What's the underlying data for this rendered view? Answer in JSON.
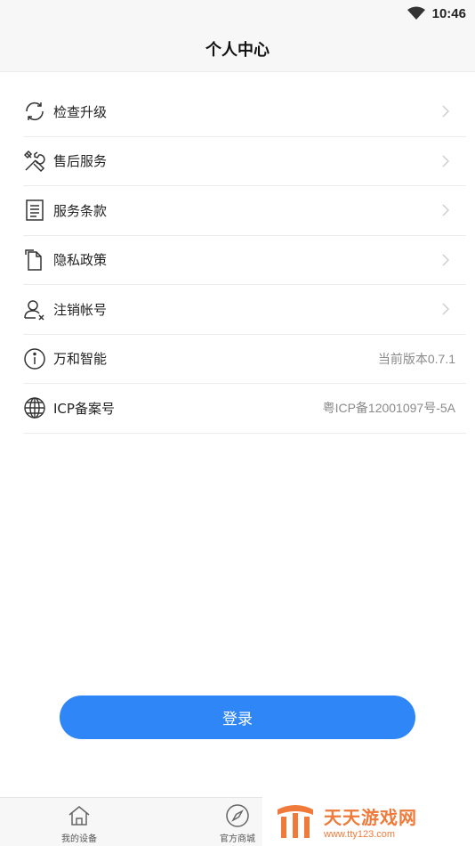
{
  "status": {
    "time": "10:46"
  },
  "header": {
    "title": "个人中心"
  },
  "menu": {
    "items": [
      {
        "label": "检查升级",
        "icon": "refresh-icon"
      },
      {
        "label": "售后服务",
        "icon": "tools-icon"
      },
      {
        "label": "服务条款",
        "icon": "document-icon"
      },
      {
        "label": "隐私政策",
        "icon": "file-icon"
      },
      {
        "label": "注销帐号",
        "icon": "user-remove-icon"
      },
      {
        "label": "万和智能",
        "icon": "info-icon",
        "value": "当前版本0.7.1"
      },
      {
        "label": "ICP备案号",
        "icon": "globe-icon",
        "value": "粤ICP备12001097号-5A"
      }
    ]
  },
  "login": {
    "label": "登录"
  },
  "tabbar": {
    "tabs": [
      {
        "label": "我的设备",
        "icon": "home-icon"
      },
      {
        "label": "官方商城",
        "icon": "compass-icon"
      }
    ]
  },
  "watermark": {
    "title": "天天游戏网",
    "url": "www.tty123.com"
  },
  "colors": {
    "accent": "#2f86f6",
    "watermark": "#f07a3a"
  }
}
